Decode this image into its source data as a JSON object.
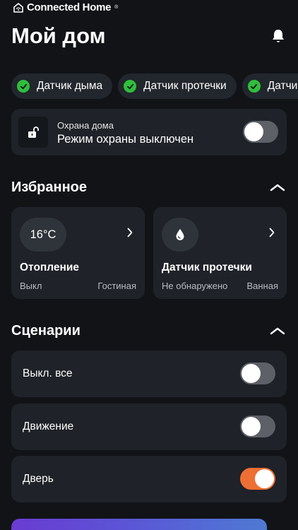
{
  "app": {
    "brand_name": "Connected Home",
    "brand_mark": "®",
    "page_title": "Мой дом",
    "icons": {
      "logo": "house-wifi-icon",
      "notifications": "bell-icon"
    }
  },
  "status_chips": [
    {
      "label": "Датчик дыма",
      "status": "ok"
    },
    {
      "label": "Датчик протечки",
      "status": "ok"
    },
    {
      "label": "Датчик",
      "status": "ok"
    }
  ],
  "security": {
    "title": "Охрана дома",
    "mode_text": "Режим охраны выключен",
    "enabled": false,
    "icon": "unlocked-padlock-icon"
  },
  "favorites": {
    "title": "Избранное",
    "collapsed": false,
    "items": [
      {
        "badge": "16°C",
        "name": "Отопление",
        "state": "Выкл",
        "room": "Гостиная",
        "icon": "temperature-badge"
      },
      {
        "badge": "",
        "name": "Датчик протечки",
        "state": "Не обнаружено",
        "room": "Ванная",
        "icon": "water-drop-icon"
      }
    ]
  },
  "scenarios": {
    "title": "Сценарии",
    "collapsed": false,
    "items": [
      {
        "label": "Выкл. все",
        "enabled": false
      },
      {
        "label": "Движение",
        "enabled": false
      },
      {
        "label": "Дверь",
        "enabled": true
      }
    ]
  },
  "colors": {
    "background": "#111317",
    "card": "#1f2228",
    "ok_green": "#2fbf3c",
    "toggle_on": "#ee6f33",
    "toggle_off": "#5d6066"
  }
}
